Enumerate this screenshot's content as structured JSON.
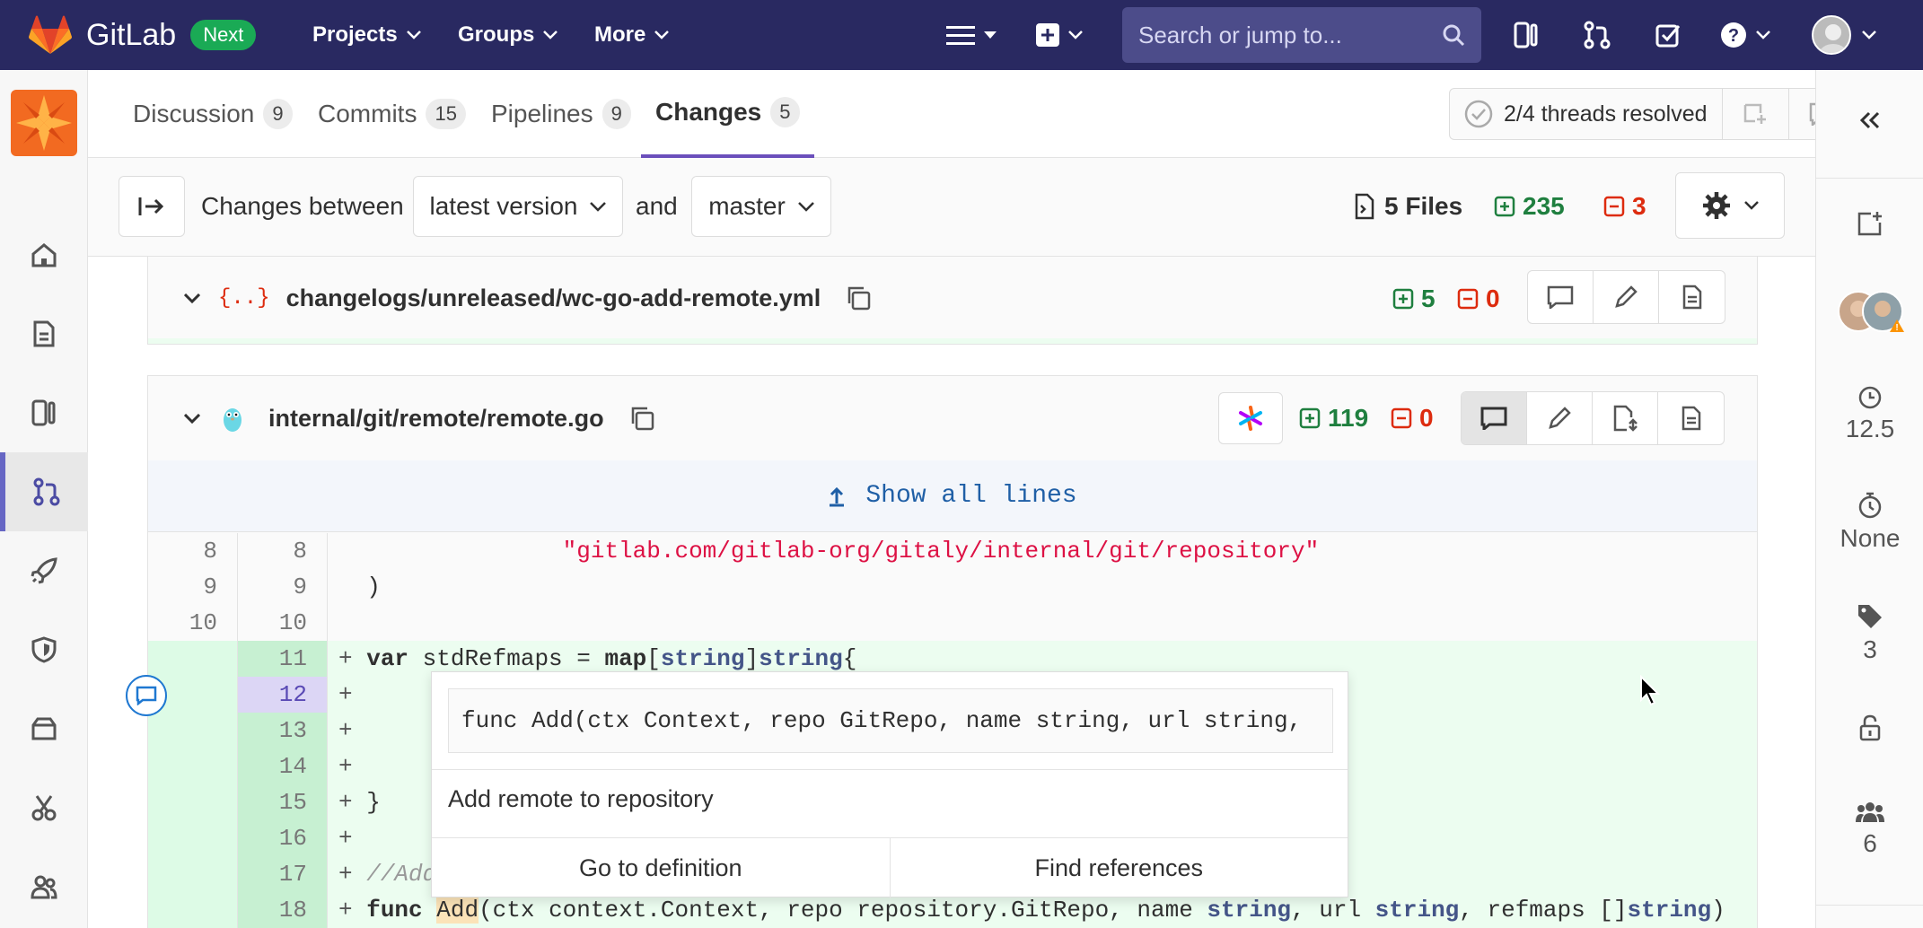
{
  "topbar": {
    "brand": "GitLab",
    "badge": "Next",
    "menus": [
      "Projects",
      "Groups",
      "More"
    ],
    "search_placeholder": "Search or jump to..."
  },
  "tabs": [
    {
      "label": "Discussion",
      "count": "9"
    },
    {
      "label": "Commits",
      "count": "15"
    },
    {
      "label": "Pipelines",
      "count": "9"
    },
    {
      "label": "Changes",
      "count": "5"
    }
  ],
  "threads": {
    "label": "2/4 threads resolved"
  },
  "changes_bar": {
    "label": "Changes between",
    "version": "latest version",
    "and": "and",
    "target": "master",
    "files": "5 Files",
    "additions": "235",
    "deletions": "3"
  },
  "files": [
    {
      "name": "changelogs/unreleased/wc-go-add-remote.yml",
      "additions": "5",
      "deletions": "0"
    },
    {
      "name": "internal/git/remote/remote.go",
      "additions": "119",
      "deletions": "0"
    }
  ],
  "show_all": "Show all lines",
  "diff_lines": [
    {
      "old": "8",
      "new": "8",
      "prefix": " ",
      "code": "\t\"gitlab.com/gitlab-org/gitaly/internal/git/repository\""
    },
    {
      "old": "9",
      "new": "9",
      "prefix": " ",
      "code": ")"
    },
    {
      "old": "10",
      "new": "10",
      "prefix": " ",
      "code": ""
    },
    {
      "old": "",
      "new": "11",
      "prefix": "+",
      "code": "var stdRefmaps = map[string]string{"
    },
    {
      "old": "",
      "new": "12",
      "prefix": "+",
      "code": ""
    },
    {
      "old": "",
      "new": "13",
      "prefix": "+",
      "code": ""
    },
    {
      "old": "",
      "new": "14",
      "prefix": "+",
      "code": ""
    },
    {
      "old": "",
      "new": "15",
      "prefix": "+",
      "code": "}"
    },
    {
      "old": "",
      "new": "16",
      "prefix": "+",
      "code": ""
    },
    {
      "old": "",
      "new": "17",
      "prefix": "+",
      "code": "//Add"
    },
    {
      "old": "",
      "new": "18",
      "prefix": "+",
      "code": "func Add(ctx context.Context, repo repository.GitRepo, name string, url string, refmaps []string)"
    }
  ],
  "popover": {
    "signature": "func Add(ctx Context, repo GitRepo, name string, url string,",
    "description": "Add remote to repository",
    "goto": "Go to definition",
    "refs": "Find references"
  },
  "rightbar": {
    "time_spent": "12.5",
    "estimate": "None",
    "labels": "3",
    "participants": "6"
  }
}
